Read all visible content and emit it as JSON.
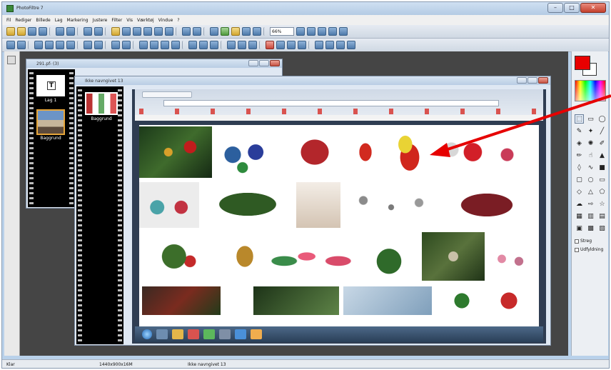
{
  "app": {
    "title": "PhotoFiltre 7"
  },
  "menu": [
    "Fil",
    "Rediger",
    "Billede",
    "Lag",
    "Markering",
    "Justere",
    "Filter",
    "Vis",
    "Værktøj",
    "Vindue",
    "?"
  ],
  "toolbar": {
    "zoom": "66%"
  },
  "windows": {
    "layer_doc": {
      "title": "291.pf- (3)",
      "layers": [
        {
          "label": "Lag 1"
        },
        {
          "label": "Baggrund"
        }
      ]
    },
    "main_doc": {
      "title": "Ikke navngivet 13",
      "layers": [
        {
          "label": "Baggrund"
        }
      ]
    }
  },
  "palette": {
    "fg_color": "#e80000",
    "bg_color": "#ffffff",
    "checkboxes": [
      "Streg",
      "Udfyldning"
    ]
  },
  "status": {
    "left": "Klar",
    "size": "1440x900x16M",
    "name": "Ikke navngivet 13"
  },
  "colors": {
    "annotation_arrow": "#e60000"
  }
}
